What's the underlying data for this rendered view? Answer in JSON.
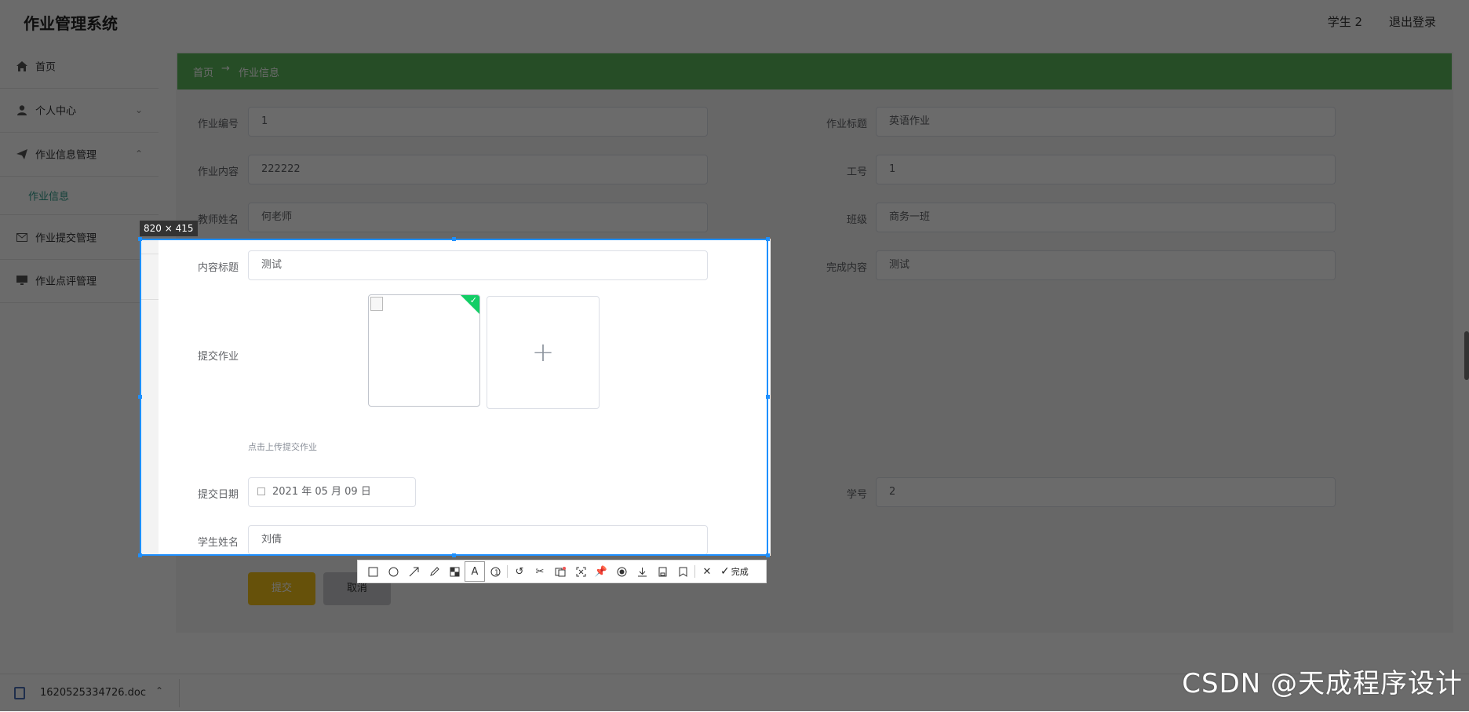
{
  "header": {
    "app_title": "作业管理系统",
    "user": "学生 2",
    "logout": "退出登录"
  },
  "sidebar": {
    "items": [
      {
        "label": "首页"
      },
      {
        "label": "个人中心"
      },
      {
        "label": "作业信息管理"
      },
      {
        "label": "作业信息"
      },
      {
        "label": "作业提交管理"
      },
      {
        "label": "作业点评管理"
      }
    ]
  },
  "breadcrumb": {
    "home": "首页",
    "current": "作业信息",
    "separator": "→"
  },
  "form": {
    "labels": {
      "job_no": "作业编号",
      "job_title": "作业标题",
      "job_content": "作业内容",
      "work_no": "工号",
      "teacher": "教师姓名",
      "class": "班级",
      "content_title": "内容标题",
      "finish_content": "完成内容",
      "submit_work": "提交作业",
      "submit_date": "提交日期",
      "student_no": "学号",
      "student_name": "学生姓名"
    },
    "values": {
      "job_no": "1",
      "job_title": "英语作业",
      "job_content": "222222",
      "work_no": "1",
      "teacher": "何老师",
      "class": "商务一班",
      "content_title": "测试",
      "finish_content": "测试",
      "submit_date": "2021 年 05 月 09 日",
      "student_no": "2",
      "student_name": "刘倩"
    },
    "upload_tip": "点击上传提交作业",
    "submit": "提交",
    "cancel": "取消"
  },
  "capture": {
    "size_label": "820 × 415",
    "done_label": "完成",
    "tools": [
      "rectangle-icon",
      "ellipse-icon",
      "arrow-icon",
      "pen-icon",
      "mosaic-icon",
      "text-icon",
      "serial-number-icon",
      "undo-icon",
      "cutout-icon",
      "ocr-icon",
      "scroll-capture-icon",
      "pin-icon",
      "record-icon",
      "download-icon",
      "save-icon",
      "bookmark-icon",
      "close-icon",
      "check-icon"
    ],
    "accent": "#1e90ff"
  },
  "download_bar": {
    "file_name": "1620525334726.doc"
  },
  "watermark": "CSDN @天成程序设计",
  "colors": {
    "breadcrumb": "#5cb85c",
    "submit": "#f2c21a",
    "active_menu": "#2f9b8a"
  }
}
